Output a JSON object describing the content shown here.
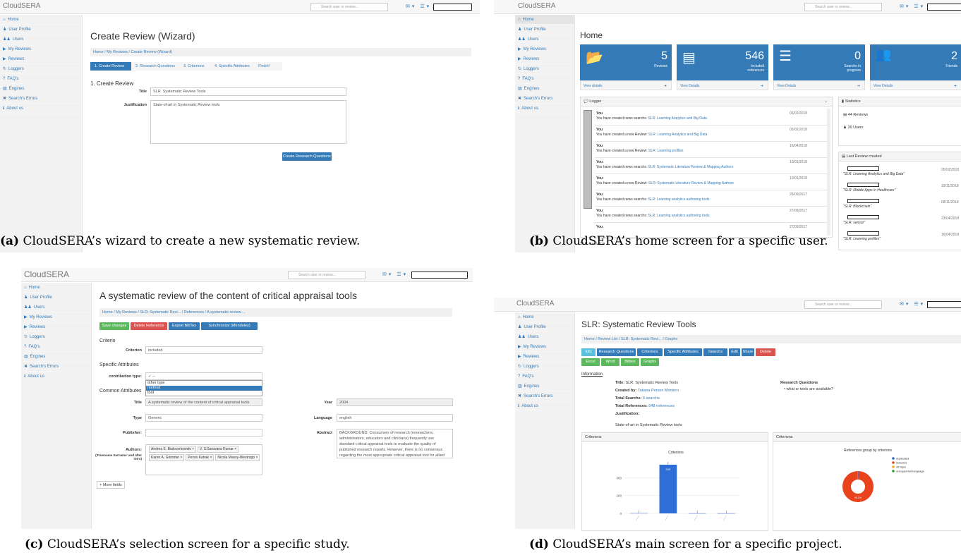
{
  "app": {
    "brand": "CloudSERA",
    "search_placeholder": "Search user or review...",
    "search_btn": "Q",
    "nav_icons": "✉▾ ☰▾ ♟"
  },
  "sidebar": [
    "Home",
    "User Profile",
    "Users",
    "My Reviews",
    "Reviews",
    "Loggers",
    "FAQ's",
    "Engines",
    "Search's Errors",
    "About us"
  ],
  "sidebar_icons": [
    "⌂",
    "♟",
    "♟♟",
    "▶",
    "▶",
    "↻",
    "?",
    "▥",
    "✖",
    "ℹ"
  ],
  "panel_a": {
    "caption_label": "(a)",
    "caption": " CloudSERA’s wizard to create a new systematic review.",
    "title": "Create Review (Wizard)",
    "breadcrumb": "Home / My Reviews / Create Review (Wizard)",
    "steps": [
      "1. Create Review",
      "2. Research Questions",
      "3. Criterions",
      "4. Specific Attributes",
      "Finish!"
    ],
    "section": "1. Create Review",
    "title_label": "Title",
    "title_prefix": "SLR",
    "title_value": "Systematic Review Tools",
    "justification_label": "Justification",
    "justification_value": "State-of-art in Systematic Review tools",
    "button": "Create Research Questions"
  },
  "panel_b": {
    "caption_label": "(b)",
    "caption": " CloudSERA’s home screen for a specific user.",
    "title": "Home",
    "tiles": [
      {
        "num": "5",
        "cap": "Reviews",
        "foot": "View details"
      },
      {
        "num": "546",
        "cap": "Included references",
        "foot": "View Details"
      },
      {
        "num": "0",
        "cap": "Searchs in progress",
        "foot": "View Details"
      },
      {
        "num": "2",
        "cap": "Friends",
        "foot": "View Details"
      }
    ],
    "logger_title": "Logger",
    "stats_title": "Statistics",
    "stats": [
      "44 Reviews",
      "26 Users"
    ],
    "last_review_title": "Last Review created",
    "logs": [
      {
        "who": "You",
        "text": "You have created news searchs:",
        "link": "SLR: Learning Analytics and Big Data",
        "date": "06/02/2018"
      },
      {
        "who": "You",
        "text": "You have created a new Review:",
        "link": "SLR: Learning Analytics and Big Data",
        "date": "05/02/2018"
      },
      {
        "who": "You",
        "text": "You have created a new Review:",
        "link": "SLR: Learning profiles",
        "date": "16/04/2018"
      },
      {
        "who": "You",
        "text": "You have created news searchs:",
        "link": "SLR: Systematic Literature Review & Mapping Authors",
        "date": "10/01/2018"
      },
      {
        "who": "You",
        "text": "You have created a new Review:",
        "link": "SLR: Systematic Literature Review & Mapping Authors",
        "date": "10/01/2018"
      },
      {
        "who": "You",
        "text": "You have created news searchs:",
        "link": "SLR: Learning analytics authoring tools",
        "date": "28/09/2017"
      },
      {
        "who": "You",
        "text": "You have created news searchs:",
        "link": "SLR: Learning analytics authoring tools",
        "date": "27/09/2017"
      },
      {
        "who": "You",
        "text": "",
        "link": "",
        "date": "27/09/2017"
      }
    ],
    "last_reviews": [
      {
        "name": "\"SLR: Learning Analytics and Big Data\"",
        "date": "05/02/2018"
      },
      {
        "name": "\"SLR: Mobile Apps in Healthcare\"",
        "date": "19/11/2018"
      },
      {
        "name": "\"SLR: Blockchain\"",
        "date": "08/11/2018"
      },
      {
        "name": "\"SLR: sensor\"",
        "date": "23/04/2018"
      },
      {
        "name": "\"SLR: Learning profiles\"",
        "date": "16/04/2018"
      }
    ],
    "slr_created": "SLR createds"
  },
  "panel_c": {
    "caption_label": "(c)",
    "caption": " CloudSERA’s selection screen for a specific study.",
    "title": "A systematic review of the content of critical appraisal tools",
    "breadcrumb": "Home / My Reviews / SLR: Systematic Revi... / References / A systematic review ...",
    "buttons": [
      "Save changes",
      "Delete Reference",
      "Export BibTex",
      "Synchronize (Mendeley)"
    ],
    "criterio": "Criterio",
    "criterion_label": "Criterion",
    "criterion_value": "included",
    "specific": "Specific Attributes",
    "contribution_label": "contribution type:",
    "contribution_value": "✓ --",
    "dropdown": [
      "other type",
      "method",
      "tool"
    ],
    "common": "Common Attributes",
    "title_label": "Title",
    "title_value": "A systematic review of the content of critical appraisal tools",
    "year_label": "Year",
    "year_value": "2004",
    "type_label": "Type",
    "type_value": "Generic",
    "language_label": "Language",
    "language_value": "english",
    "publisher_label": "Publisher:",
    "abstract_label": "Abstract",
    "abstract_lines": [
      "BACKGROUND: Consumers of research (researchers,",
      "administrators, educators and clinicians) frequently use",
      "standard critical appraisal tools to evaluate the quality of",
      "published research reports. However, there is no consensus",
      "regarding the most appropriate critical appraisal tool for allied"
    ],
    "authors_label": "Authors:",
    "authors_sub": "('Forename Surname' and after intro)",
    "authors": [
      "Andrea E. Bialocerkowski ×",
      "V. S.Saravana Kumar ×",
      "Karen A. Grimmer ×",
      "Persis Katrak ×",
      "Nicola Massy-Westropp ×"
    ],
    "more_fields": "+ More fields"
  },
  "panel_d": {
    "caption_label": "(d)",
    "caption": " CloudSERA’s main screen for a specific project.",
    "title": "SLR: Systematic Review Tools",
    "breadcrumb": "Home / Review List / SLR: Systematic Revi... / Graphs",
    "buttons1": [
      "Info",
      "Research Questions",
      "Criterions",
      "Specific Attributes",
      "Searchs",
      "Edit",
      "Share",
      "Delete"
    ],
    "buttons2": [
      "Excel",
      "Word",
      "Bibtex",
      "Graphs"
    ],
    "info": "Information",
    "fields": [
      {
        "k": "Title:",
        "v": "SLR: Systematic Review Tools"
      },
      {
        "k": "Created by:",
        "v": "Tatiana Person Montero"
      },
      {
        "k": "Total Searchs:",
        "v": "6 searchs"
      },
      {
        "k": "Total References:",
        "v": "548 references"
      },
      {
        "k": "Justification:",
        "v": ""
      }
    ],
    "justification_text": "State-of-art in Systematic Review tools",
    "rq_title": "Research Questions",
    "rq": "• what sr tools are available?",
    "criterions1": "Criterions",
    "criterions2": "Criterions",
    "bar_title": "Criterions",
    "bar_label": "545",
    "y_ticks": [
      "400",
      "200",
      "0"
    ],
    "pie_title": "References group by criterions",
    "pie_center": "99.1%",
    "legend": [
      "duplicated",
      "included",
      "off-topic",
      "unsupported language"
    ]
  },
  "chart_data": [
    {
      "type": "bar",
      "title": "Criterions",
      "categories": [
        "",
        "",
        "",
        ""
      ],
      "values": [
        3,
        545,
        1,
        1
      ],
      "ylim": [
        0,
        600
      ]
    },
    {
      "type": "pie",
      "title": "References group by criterions",
      "categories": [
        "duplicated",
        "included",
        "off-topic",
        "unsupported language"
      ],
      "values": [
        0.5,
        99.1,
        0.2,
        0.2
      ]
    }
  ],
  "colors": {
    "primary": "#337ab7",
    "success": "#5cb85c",
    "danger": "#d9534f",
    "info": "#5bc0de",
    "pie_main": "#e8431d",
    "bar": "#2f6ed6"
  }
}
